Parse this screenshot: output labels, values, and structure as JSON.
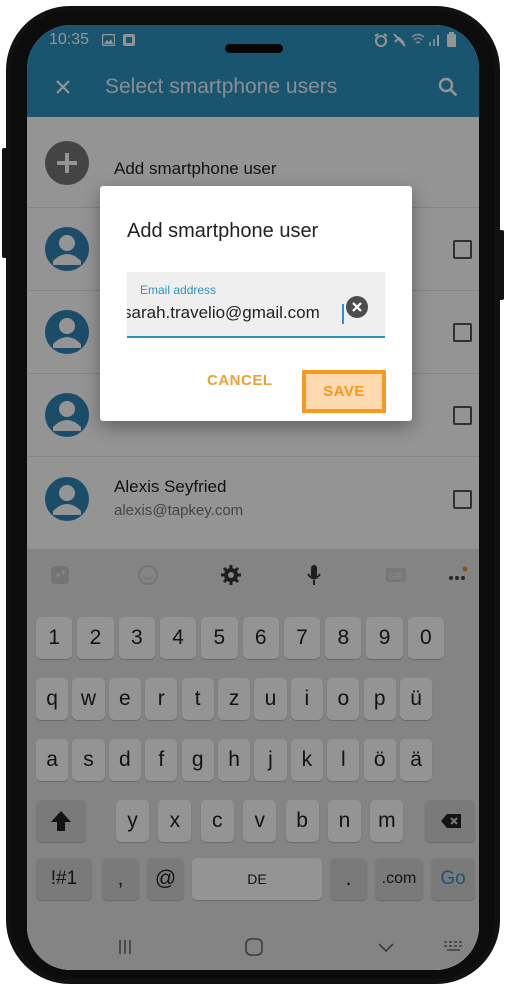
{
  "status_bar": {
    "time": "10:35"
  },
  "app_bar": {
    "title": "Select smartphone users",
    "close_icon": "close-icon",
    "search_icon": "search-icon"
  },
  "user_list": {
    "add_label": "Add smartphone user",
    "rows": [
      {
        "name": "",
        "email": ""
      },
      {
        "name": "",
        "email": ""
      },
      {
        "name": "",
        "email": ""
      },
      {
        "name": "Alexis Seyfried",
        "email": "alexis@tapkey.com"
      }
    ]
  },
  "dialog": {
    "title": "Add smartphone user",
    "field_label": "Email address",
    "field_value": "sarah.travelio@gmail.com",
    "cancel_label": "CANCEL",
    "save_label": "SAVE"
  },
  "keyboard": {
    "row_numbers": [
      "1",
      "2",
      "3",
      "4",
      "5",
      "6",
      "7",
      "8",
      "9",
      "0"
    ],
    "row_top": [
      "q",
      "w",
      "e",
      "r",
      "t",
      "z",
      "u",
      "i",
      "o",
      "p",
      "ü"
    ],
    "row_mid": [
      "a",
      "s",
      "d",
      "f",
      "g",
      "h",
      "j",
      "k",
      "l",
      "ö",
      "ä"
    ],
    "row_low": [
      "y",
      "x",
      "c",
      "v",
      "b",
      "n",
      "m"
    ],
    "symbols_label": "!#1",
    "comma_label": ",",
    "at_label": "@",
    "space_label": "DE",
    "period_label": ".",
    "com_label": ".com",
    "go_label": "Go"
  },
  "colors": {
    "brand": "#2d93c0",
    "accent": "#f39a1f",
    "save_fill": "#ffd9b0"
  }
}
